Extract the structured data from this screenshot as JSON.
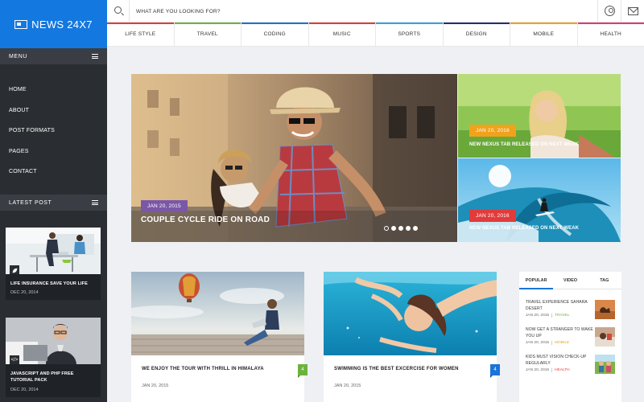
{
  "brand": {
    "name": "NEWS 24X7",
    "color": "#1378e0"
  },
  "search": {
    "placeholder": "WHAT ARE YOU LOOKING FOR?"
  },
  "header_icons": [
    "search-icon",
    "user-icon",
    "mail-icon"
  ],
  "categories": [
    {
      "label": "LIFE STYLE",
      "color": "#e23b3b"
    },
    {
      "label": "TRAVEL",
      "color": "#6cb33e"
    },
    {
      "label": "CODING",
      "color": "#1a73d9"
    },
    {
      "label": "MUSIC",
      "color": "#e23b3b"
    },
    {
      "label": "SPORTS",
      "color": "#2ea6e0"
    },
    {
      "label": "DESIGN",
      "color": "#2b2d6e"
    },
    {
      "label": "MOBILE",
      "color": "#f0a21b"
    },
    {
      "label": "HEALTH",
      "color": "#e23b6e"
    }
  ],
  "sidebar": {
    "menu_label": "MENU",
    "menu_items": [
      "HOME",
      "ABOUT",
      "POST FORMATS",
      "PAGES",
      "CONTACT"
    ],
    "latest_label": "LATEST POST",
    "latest_posts": [
      {
        "title": "LIFE INSURANCE SAVE YOUR LIFE",
        "date": "DEC 20, 2014",
        "icon": "leaf-icon"
      },
      {
        "title": "JAVASCRIPT AND PHP FREE TUTORIAL PACK",
        "date": "DEC 20, 2014",
        "icon": "code-icon"
      }
    ]
  },
  "hero": {
    "date": "JAN 20, 2015",
    "title": "COUPLE CYCLE RIDE ON ROAD",
    "badge_color": "#7b57a8",
    "slide_count": 5,
    "active_slide": 1
  },
  "side_cards": [
    {
      "date": "JAN 20, 2016",
      "title": "NEW NEXUS TAB RELEASED ON NEXT WEAK",
      "badge_color": "#f0a21b"
    },
    {
      "date": "JAN 20, 2016",
      "title": "NEW NEXUS TAB RELEASED ON NEXT WEAK",
      "badge_color": "#e23b3b"
    }
  ],
  "articles": [
    {
      "title": "WE ENJOY THE TOUR WITH THRILL IN HIMALAYA",
      "date": "JAN 20, 2015",
      "count": "4"
    },
    {
      "title": "SWIMMING IS THE BEST EXCERCISE FOR WOMEN",
      "date": "JAN 20, 2015",
      "count": "4"
    }
  ],
  "widget": {
    "tabs": [
      "POPULAR",
      "VIDEO",
      "TAG"
    ],
    "active_tab": "POPULAR",
    "items": [
      {
        "title": "TRAVEL EXPERIENCE SAHARA DESERT",
        "date": "JAN 20, 2015",
        "tag": "TRAVEL",
        "tag_color": "#6cb33e"
      },
      {
        "title": "NOW GET A STRANGER TO WAKE YOU UP",
        "date": "JAN 20, 2015",
        "tag": "MOBILE",
        "tag_color": "#f0a21b"
      },
      {
        "title": "KIDS MUST VISION CHECK-UP REGULARLY",
        "date": "JAN 20, 2015",
        "tag": "HEALTH",
        "tag_color": "#e23b3b"
      }
    ]
  }
}
